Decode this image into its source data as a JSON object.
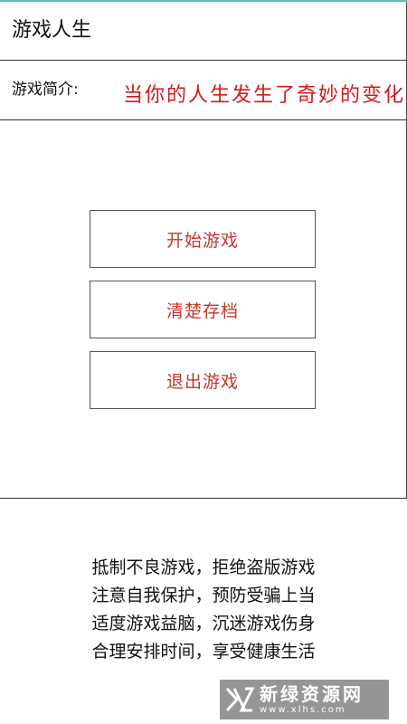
{
  "header": {
    "title": "游戏人生"
  },
  "intro": {
    "label": "游戏简介:",
    "marquee_text": "当你的人生发生了奇妙的变化"
  },
  "menu": {
    "start_label": "开始游戏",
    "clear_label": "清楚存档",
    "exit_label": "退出游戏"
  },
  "notice": {
    "lines": [
      "抵制不良游戏，拒绝盗版游戏",
      "注意自我保护，预防受骗上当",
      "适度游戏益脑，沉迷游戏伤身",
      "合理安排时间，享受健康生活"
    ]
  },
  "watermark": {
    "name": "新绿资源网",
    "url": "www.xlhs.com"
  },
  "colors": {
    "accent_red": "#c0392b",
    "marquee_red": "#d11a1a",
    "top_accent": "#5fbfbf"
  }
}
